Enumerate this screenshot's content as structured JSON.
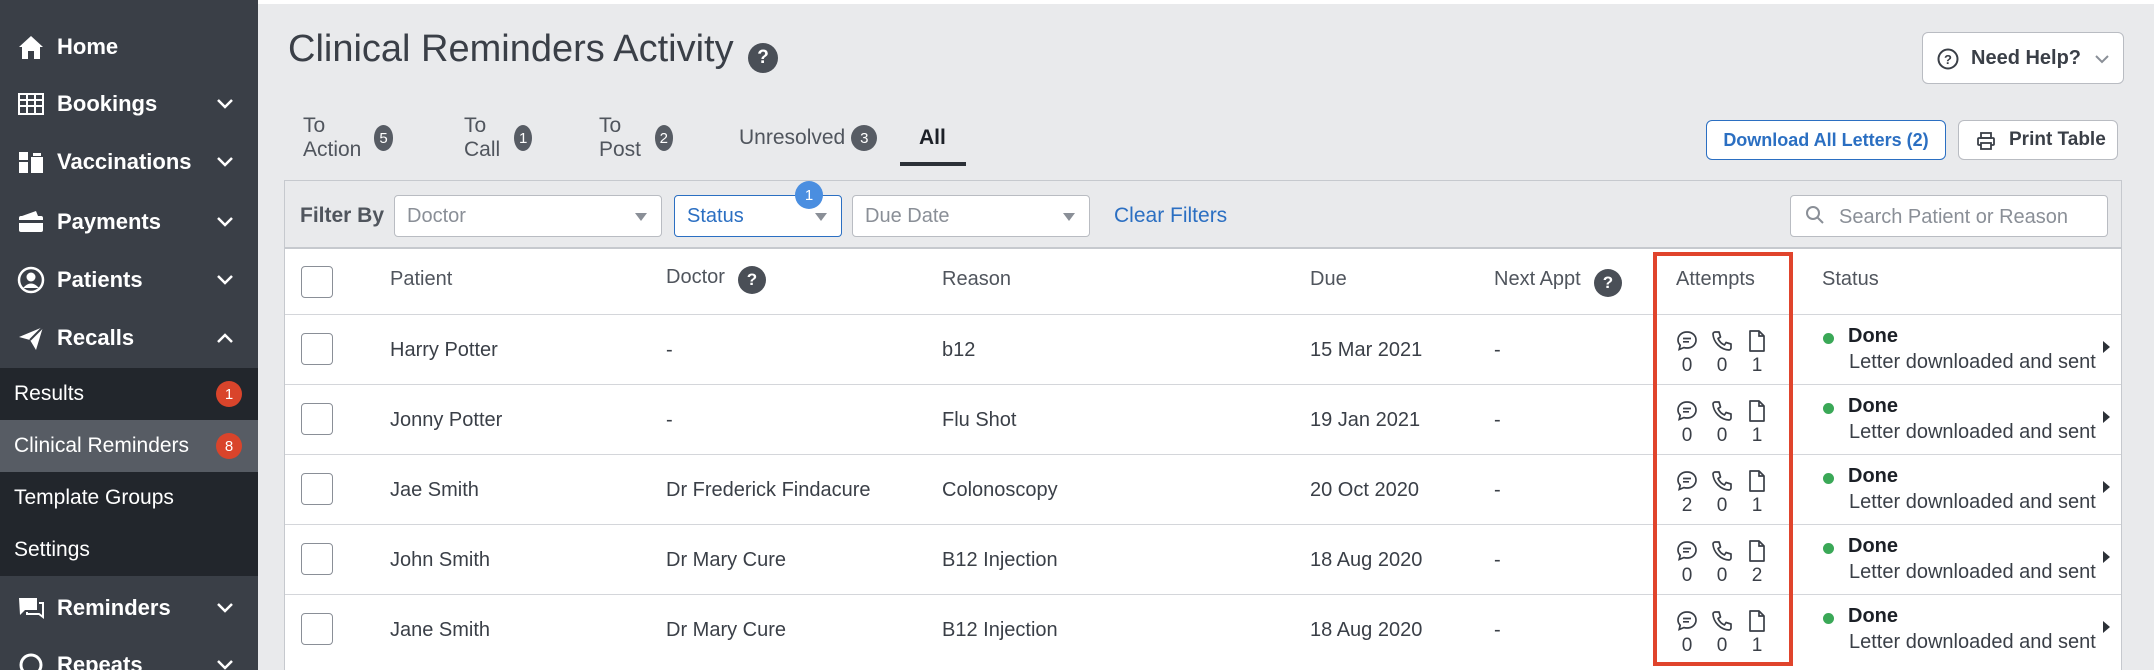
{
  "sidebar": {
    "items": [
      {
        "label": "Home",
        "icon": "home-icon"
      },
      {
        "label": "Bookings",
        "icon": "grid-icon"
      },
      {
        "label": "Vaccinations",
        "icon": "vials-icon"
      },
      {
        "label": "Payments",
        "icon": "payments-icon"
      },
      {
        "label": "Patients",
        "icon": "user-circle-icon"
      },
      {
        "label": "Recalls",
        "icon": "paper-plane-icon"
      }
    ],
    "recall_sub": [
      {
        "label": "Results",
        "badge": "1"
      },
      {
        "label": "Clinical Reminders",
        "badge": "8"
      },
      {
        "label": "Template Groups"
      },
      {
        "label": "Settings"
      }
    ],
    "bottom_items": [
      {
        "label": "Reminders",
        "icon": "chat-icon"
      },
      {
        "label": "Repeats",
        "icon": "repeat-icon"
      }
    ]
  },
  "header": {
    "title": "Clinical Reminders Activity",
    "help_button": "Need Help?"
  },
  "tabs": [
    {
      "label": "To Action",
      "count": "5"
    },
    {
      "label": "To Call",
      "count": "1"
    },
    {
      "label": "To Post",
      "count": "2"
    },
    {
      "label": "Unresolved",
      "count": "3"
    },
    {
      "label": "All"
    }
  ],
  "actions": {
    "download": "Download All Letters (2)",
    "print": "Print Table"
  },
  "filters": {
    "label": "Filter By",
    "doctor": "Doctor",
    "status": "Status",
    "status_count": "1",
    "due_date": "Due Date",
    "clear": "Clear Filters",
    "search_placeholder": "Search Patient or Reason"
  },
  "table": {
    "columns": [
      "Patient",
      "Doctor",
      "Reason",
      "Due",
      "Next Appt",
      "Attempts",
      "Status"
    ],
    "rows": [
      {
        "patient": "Harry Potter",
        "doctor": "-",
        "reason": "b12",
        "due": "15 Mar 2021",
        "next": "-",
        "sms": "0",
        "call": "0",
        "letter": "1",
        "status": "Done",
        "note": "Letter downloaded and sent"
      },
      {
        "patient": "Jonny Potter",
        "doctor": "-",
        "reason": "Flu Shot",
        "due": "19 Jan 2021",
        "next": "-",
        "sms": "0",
        "call": "0",
        "letter": "1",
        "status": "Done",
        "note": "Letter downloaded and sent"
      },
      {
        "patient": "Jae Smith",
        "doctor": "Dr Frederick Findacure",
        "reason": "Colonoscopy",
        "due": "20 Oct 2020",
        "next": "-",
        "sms": "2",
        "call": "0",
        "letter": "1",
        "status": "Done",
        "note": "Letter downloaded and sent"
      },
      {
        "patient": "John Smith",
        "doctor": "Dr Mary Cure",
        "reason": "B12 Injection",
        "due": "18 Aug 2020",
        "next": "-",
        "sms": "0",
        "call": "0",
        "letter": "2",
        "status": "Done",
        "note": "Letter downloaded and sent"
      },
      {
        "patient": "Jane Smith",
        "doctor": "Dr Mary Cure",
        "reason": "B12 Injection",
        "due": "18 Aug 2020",
        "next": "-",
        "sms": "0",
        "call": "0",
        "letter": "1",
        "status": "Done",
        "note": "Letter downloaded and sent"
      }
    ]
  },
  "colors": {
    "sidebar": "#3a3f47",
    "accent": "#2b6fc2",
    "done": "#3aa857",
    "highlight": "#e0442c",
    "badge": "#d9442b"
  }
}
